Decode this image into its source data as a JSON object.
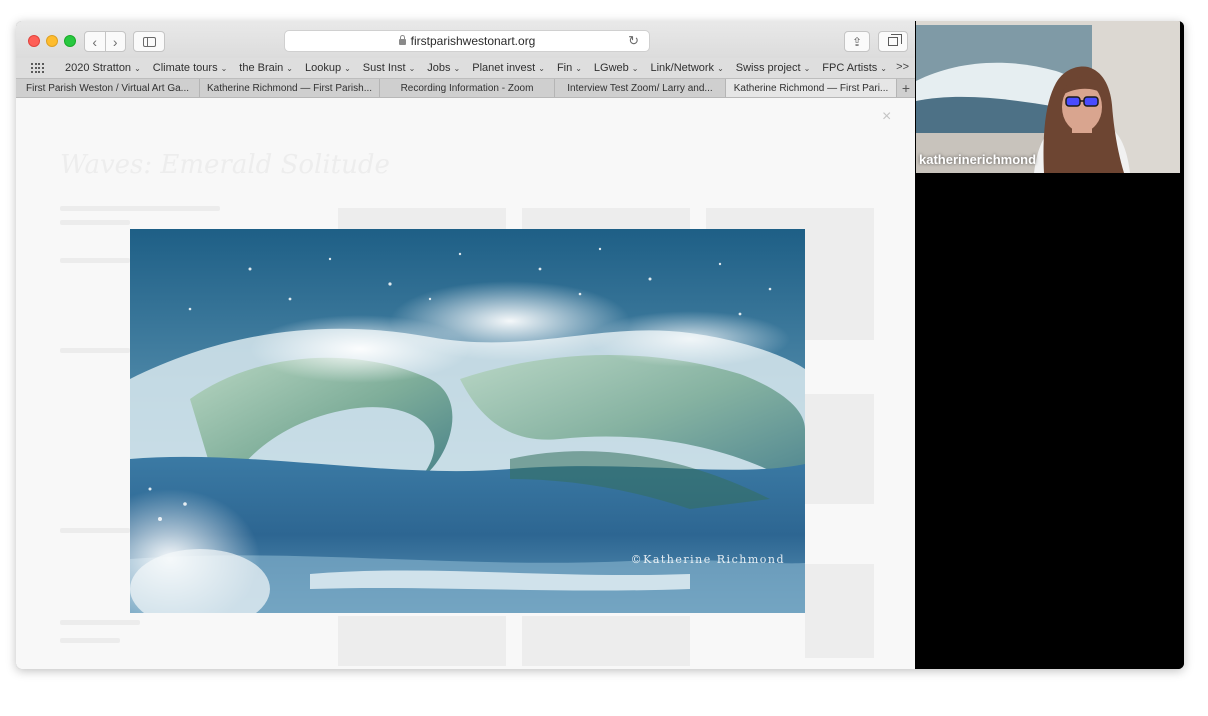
{
  "browser": {
    "url": "firstparishwestonart.org",
    "nav_back": "‹",
    "nav_forward": "›",
    "reload_icon": "↻",
    "share_icon": "⇪",
    "bookmarks": [
      {
        "label": "2020 Stratton",
        "chevron": "⌄"
      },
      {
        "label": "Climate tours",
        "chevron": "⌄"
      },
      {
        "label": "the Brain",
        "chevron": "⌄"
      },
      {
        "label": "Lookup",
        "chevron": "⌄"
      },
      {
        "label": "Sust Inst",
        "chevron": "⌄"
      },
      {
        "label": "Jobs",
        "chevron": "⌄"
      },
      {
        "label": "Planet invest",
        "chevron": "⌄"
      },
      {
        "label": "Fin",
        "chevron": "⌄"
      },
      {
        "label": "LGweb",
        "chevron": "⌄"
      },
      {
        "label": "Link/Network",
        "chevron": "⌄"
      },
      {
        "label": "Swiss project",
        "chevron": "⌄"
      },
      {
        "label": "FPC Artists",
        "chevron": "⌄"
      }
    ],
    "bookmarks_more": ">>",
    "tabs": [
      {
        "label": "First Parish Weston / Virtual Art Ga...",
        "active": false
      },
      {
        "label": "Katherine Richmond — First Parish...",
        "active": false
      },
      {
        "label": "Recording Information - Zoom",
        "active": false
      },
      {
        "label": "Interview Test Zoom/ Larry and...",
        "active": false
      },
      {
        "label": "Katherine Richmond — First Pari...",
        "active": true
      }
    ],
    "tab_add": "+"
  },
  "page": {
    "close_icon": "×",
    "faded_title": "Waves: Emerald Solitude",
    "image_copyright": "©Katherine Richmond"
  },
  "zoom": {
    "participant_name": "katherinerichmond"
  }
}
